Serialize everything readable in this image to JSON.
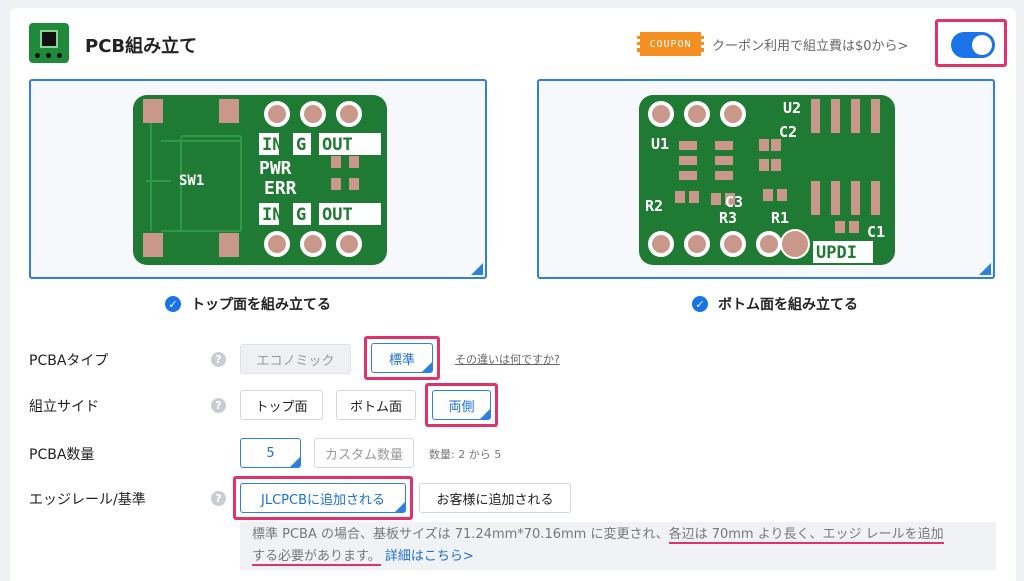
{
  "header": {
    "title": "PCB組み立て",
    "coupon_badge": "COUPON",
    "coupon_text": "クーポン利用で組立費は$0から>",
    "toggle_on": true
  },
  "sides": {
    "top_label": "トップ面を組み立てる",
    "bottom_label": "ボトム面を組み立てる"
  },
  "pcb_top": {
    "labels": [
      "SW1",
      "IN",
      "G",
      "OUT",
      "PWR",
      "ERR",
      "IN",
      "G",
      "OUT"
    ]
  },
  "pcb_bottom": {
    "labels": [
      "U2",
      "C2",
      "U1",
      "C3",
      "R2",
      "R3",
      "R1",
      "C1",
      "UPDI"
    ]
  },
  "pcba_type": {
    "label": "PCBAタイプ",
    "options": [
      "エコノミック",
      "標準"
    ],
    "selected": "標準",
    "link": "その違いは何ですか?"
  },
  "assembly_side": {
    "label": "組立サイド",
    "options": [
      "トップ面",
      "ボトム面",
      "両側"
    ],
    "selected": "両側"
  },
  "quantity": {
    "label": "PCBA数量",
    "value": "5",
    "custom_placeholder": "カスタム数量",
    "hint": "数量: 2 から 5"
  },
  "edge_rail": {
    "label": "エッジレール/基準",
    "options": [
      "JLCPCBに追加される",
      "お客様に追加される"
    ],
    "selected": "JLCPCBに追加される"
  },
  "note": {
    "part1": "標準 PCBA の場合、基板サイズは 71.24mm*70.16mm に変更され、",
    "part2": "各辺は 70mm より長く、エッジ レールを追加",
    "part3": "する必要があります。",
    "more": "詳細はこちら>"
  },
  "colors": {
    "accent": "#1a73e8",
    "highlight": "#e0336b",
    "pcb_green": "#1f7a34",
    "pad": "#c9988a"
  }
}
